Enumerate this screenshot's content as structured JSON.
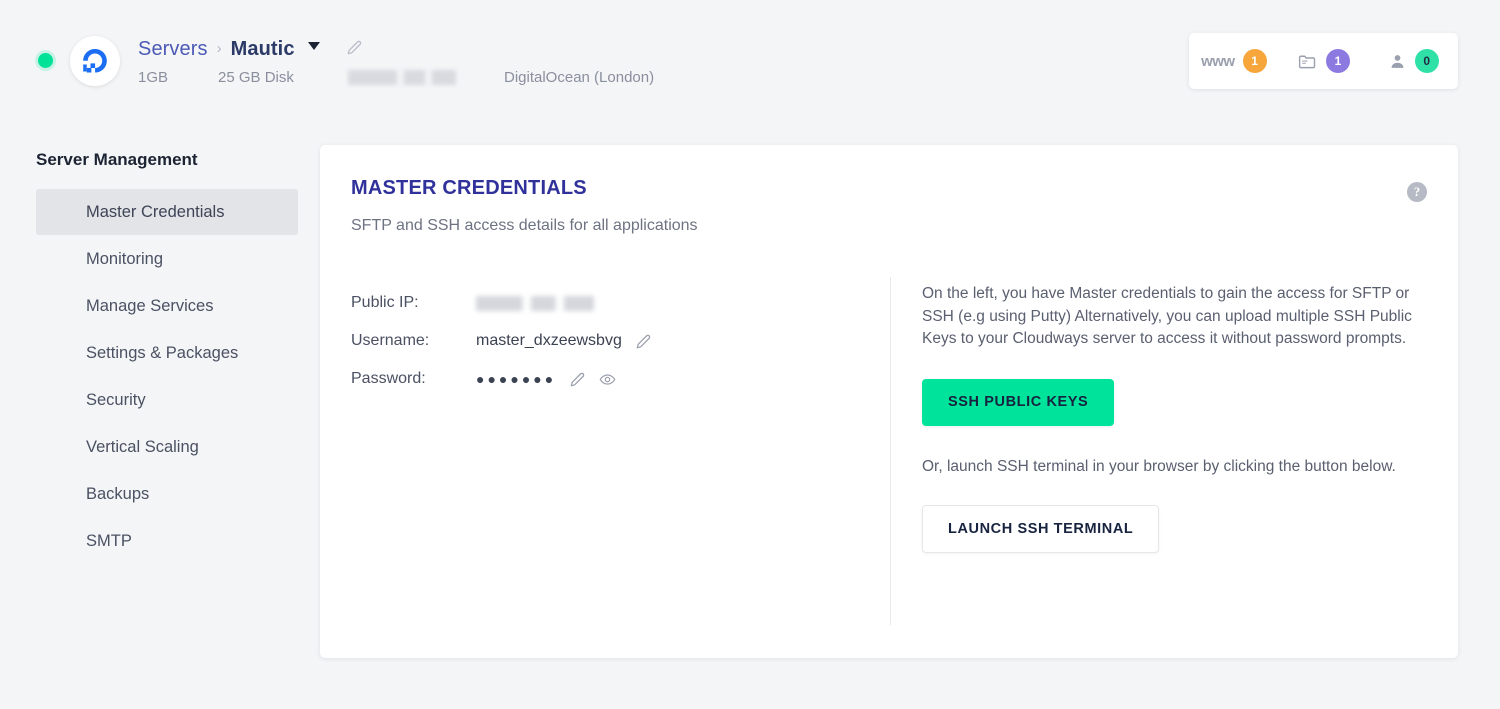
{
  "topbar": {
    "status": "online",
    "logo_icon": "digitalocean-logo-icon",
    "breadcrumb": {
      "root_label": "Servers",
      "separator": "›",
      "current_label": "Mautic",
      "caret_icon": "chevron-down-icon",
      "edit_icon": "pencil-icon"
    },
    "meta": {
      "ram": "1GB",
      "disk": "25 GB Disk",
      "ip_redacted": "",
      "provider": "DigitalOcean (London)"
    },
    "stats": [
      {
        "name": "applications",
        "label": "www",
        "count": "1",
        "color": "#f7a63b",
        "icon": "www-icon"
      },
      {
        "name": "projects",
        "label": "",
        "count": "1",
        "color": "#8c7ae0",
        "icon": "folder-icon"
      },
      {
        "name": "team-members",
        "label": "",
        "count": "0",
        "color": "#2fe1a7",
        "icon": "user-icon"
      }
    ]
  },
  "sidebar": {
    "title": "Server Management",
    "items": [
      {
        "label": "Master Credentials",
        "active": true
      },
      {
        "label": "Monitoring",
        "active": false
      },
      {
        "label": "Manage Services",
        "active": false
      },
      {
        "label": "Settings & Packages",
        "active": false
      },
      {
        "label": "Security",
        "active": false
      },
      {
        "label": "Vertical Scaling",
        "active": false
      },
      {
        "label": "Backups",
        "active": false
      },
      {
        "label": "SMTP",
        "active": false
      }
    ]
  },
  "card": {
    "title": "MASTER CREDENTIALS",
    "subtitle": "SFTP and SSH access details for all applications",
    "help_icon": "?",
    "credentials": {
      "public_ip_label": "Public IP:",
      "public_ip_value": "",
      "username_label": "Username:",
      "username_value": "master_dxzeewsbvg",
      "password_label": "Password:",
      "password_value": "●●●●●●●",
      "edit_icon": "pencil-icon",
      "reveal_icon": "eye-icon"
    },
    "info": {
      "paragraph_1": "On the left, you have Master credentials to gain the access for SFTP or SSH (e.g using Putty) Alternatively, you can upload multiple SSH Public Keys to your Cloudways server to access it without password prompts.",
      "ssh_keys_button": "SSH PUBLIC KEYS",
      "paragraph_2": "Or, launch SSH terminal in your browser by clicking the button below.",
      "launch_button": "LAUNCH SSH TERMINAL"
    }
  },
  "colors": {
    "accent_green": "#00e39a",
    "brand_indigo": "#30319b",
    "status_online": "#00e396",
    "page_bg": "#f4f5f7"
  }
}
